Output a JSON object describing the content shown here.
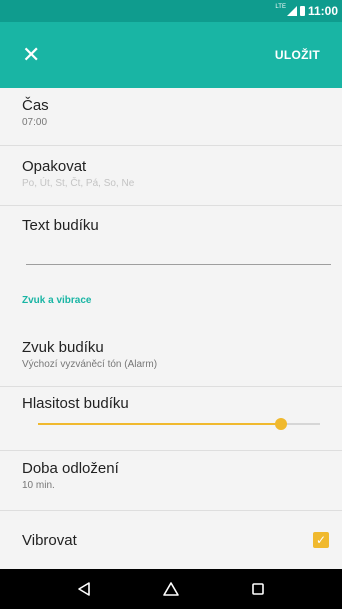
{
  "status_bar": {
    "network_label": "LTE",
    "time": "11:00"
  },
  "app_bar": {
    "close_icon": "close-icon",
    "save_label": "ULOŽIT"
  },
  "settings": {
    "time": {
      "title": "Čas",
      "value": "07:00"
    },
    "repeat": {
      "title": "Opakovat",
      "value": "Po, Út, St, Čt, Pá, So, Ne"
    },
    "alarm_text": {
      "title": "Text budíku",
      "value": ""
    },
    "section_sound": "Zvuk a vibrace",
    "alarm_sound": {
      "title": "Zvuk budíku",
      "value": "Výchozí vyzváněcí tón (Alarm)"
    },
    "volume": {
      "title": "Hlasitost budíku",
      "level": 0.86
    },
    "snooze": {
      "title": "Doba odložení",
      "value": "10 min."
    },
    "vibrate": {
      "title": "Vibrovat",
      "checked": true
    }
  },
  "colors": {
    "status_bar": "#0f9c8e",
    "app_bar": "#19b5a4",
    "accent": "#f0b92e"
  },
  "nav_bar": {
    "back_icon": "back-triangle-icon",
    "home_icon": "home-icon",
    "recents_icon": "recents-square-icon"
  }
}
